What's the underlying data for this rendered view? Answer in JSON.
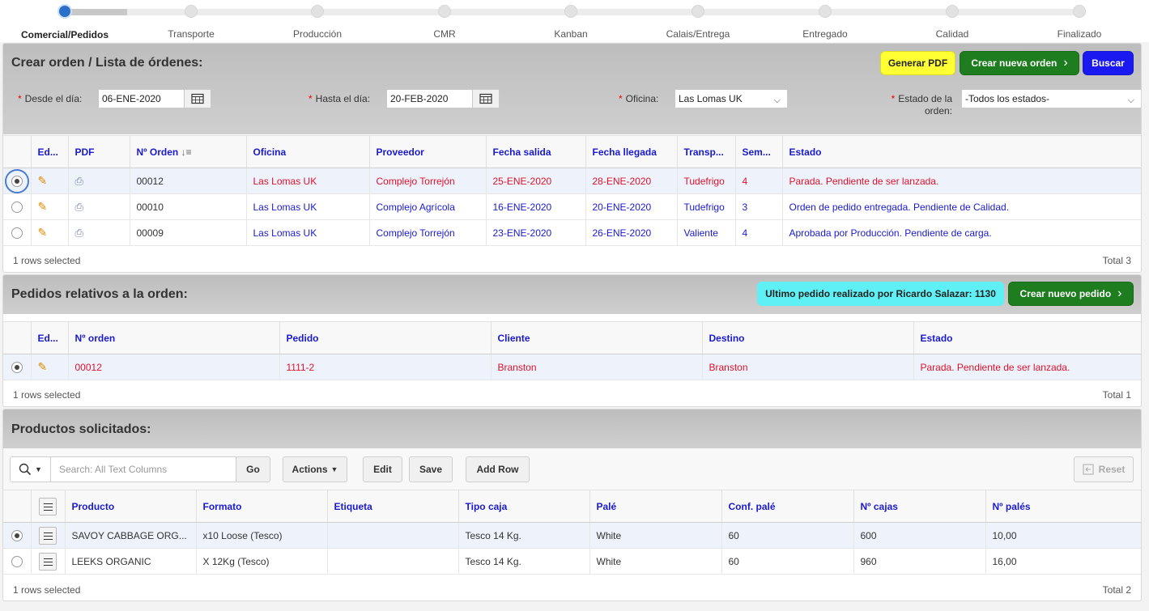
{
  "steps": [
    {
      "label": "Comercial/Pedidos",
      "active": true
    },
    {
      "label": "Transporte"
    },
    {
      "label": "Producción"
    },
    {
      "label": "CMR"
    },
    {
      "label": "Kanban"
    },
    {
      "label": "Calais/Entrega"
    },
    {
      "label": "Entregado"
    },
    {
      "label": "Calidad"
    },
    {
      "label": "Finalizado"
    }
  ],
  "orders": {
    "title": "Crear orden / Lista de órdenes:",
    "btn_pdf": "Generar PDF",
    "btn_new": "Crear nueva orden",
    "btn_search": "Buscar",
    "filters": {
      "from_label": "Desde el día:",
      "from_value": "06-ENE-2020",
      "to_label": "Hasta el día:",
      "to_value": "20-FEB-2020",
      "office_label": "Oficina:",
      "office_value": "Las Lomas UK",
      "state_label_1": "Estado de la",
      "state_label_2": "orden:",
      "state_value": "-Todos los estados-"
    },
    "headers": [
      "Ed...",
      "PDF",
      "Nº Orden",
      "Oficina",
      "Proveedor",
      "Fecha salida",
      "Fecha llegada",
      "Transp...",
      "Sem...",
      "Estado"
    ],
    "rows": [
      {
        "selected": true,
        "num": "00012",
        "oficina": "Las Lomas UK",
        "proveedor": "Complejo Torrejón",
        "salida": "25-ENE-2020",
        "llegada": "28-ENE-2020",
        "transp": "Tudefrigo",
        "sem": "4",
        "estado": "Parada. Pendiente de ser lanzada.",
        "color": "red"
      },
      {
        "selected": false,
        "num": "00010",
        "oficina": "Las Lomas UK",
        "proveedor": "Complejo Agrícola",
        "salida": "16-ENE-2020",
        "llegada": "20-ENE-2020",
        "transp": "Tudefrigo",
        "sem": "3",
        "estado": "Orden de pedido entregada. Pendiente de Calidad.",
        "color": "blue"
      },
      {
        "selected": false,
        "num": "00009",
        "oficina": "Las Lomas UK",
        "proveedor": "Complejo Torrejón",
        "salida": "23-ENE-2020",
        "llegada": "26-ENE-2020",
        "transp": "Valiente",
        "sem": "4",
        "estado": "Aprobada por Producción. Pendiente de carga.",
        "color": "blue"
      }
    ],
    "footer_left": "1 rows selected",
    "footer_right": "Total 3"
  },
  "pedidos": {
    "title": "Pedidos relativos a la orden:",
    "last_order": "Ultimo pedido realizado por Ricardo Salazar: 1130",
    "btn_new": "Crear nuevo pedido",
    "headers": [
      "Ed...",
      "Nº orden",
      "Pedido",
      "Cliente",
      "Destino",
      "Estado"
    ],
    "rows": [
      {
        "num": "00012",
        "pedido": "1111-2",
        "cliente": "Branston",
        "destino": "Branston",
        "estado": "Parada. Pendiente de ser lanzada."
      }
    ],
    "footer_left": "1 rows selected",
    "footer_right": "Total 1"
  },
  "productos": {
    "title": "Productos solicitados:",
    "search_placeholder": "Search: All Text Columns",
    "btn_go": "Go",
    "btn_actions": "Actions",
    "btn_edit": "Edit",
    "btn_save": "Save",
    "btn_addrow": "Add Row",
    "btn_reset": "Reset",
    "headers": [
      "Producto",
      "Formato",
      "Etiqueta",
      "Tipo caja",
      "Palé",
      "Conf. palé",
      "Nº cajas",
      "Nº palés"
    ],
    "rows": [
      {
        "selected": true,
        "producto": "SAVOY CABBAGE ORG...",
        "formato": "x10 Loose (Tesco)",
        "etiqueta": "",
        "caja": "Tesco 14 Kg.",
        "pale": "White",
        "conf": "60",
        "cajas": "600",
        "pales": "10,00"
      },
      {
        "selected": false,
        "producto": "LEEKS ORGANIC",
        "formato": "X 12Kg (Tesco)",
        "etiqueta": "",
        "caja": "Tesco 14 Kg.",
        "pale": "White",
        "conf": "60",
        "cajas": "960",
        "pales": "16,00"
      }
    ],
    "footer_left": "1 rows selected",
    "footer_right": "Total 2"
  }
}
